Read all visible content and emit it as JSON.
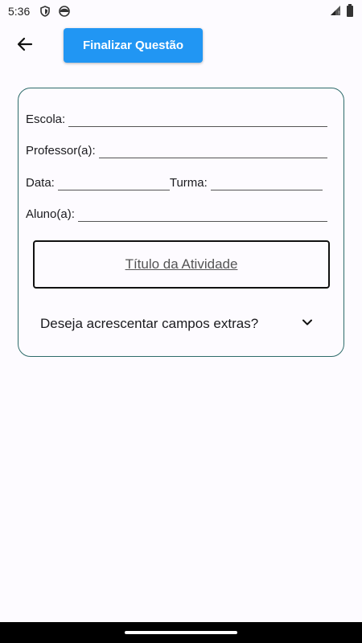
{
  "status_bar": {
    "time": "5:36",
    "icons": [
      "shield-icon",
      "face-icon",
      "signal-icon",
      "battery-icon"
    ]
  },
  "toolbar": {
    "back_icon": "arrow-left-icon",
    "finalize_label": "Finalizar Questão",
    "finalize_color": "#2196f3"
  },
  "form": {
    "escola_label": "Escola:",
    "professor_label": "Professor(a):",
    "data_label": "Data:",
    "turma_label": "Turma:",
    "aluno_label": "Aluno(a):",
    "title_text": "Título da Atividade",
    "extras_label": "Deseja acrescentar campos extras?",
    "extras_icon": "chevron-down-icon",
    "border_color": "#2e6b6b"
  }
}
